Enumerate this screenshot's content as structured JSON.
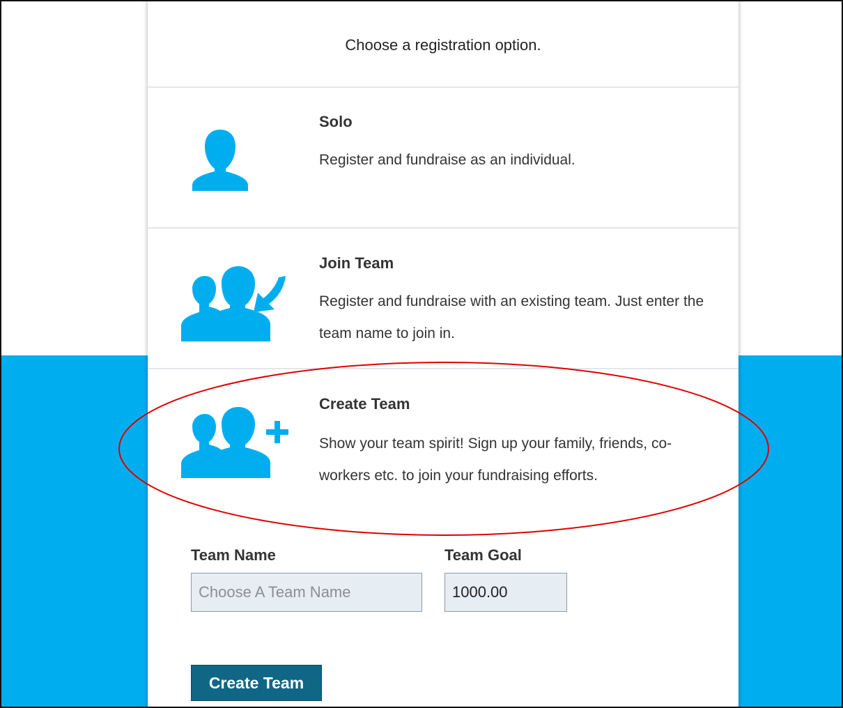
{
  "header": {
    "title": "Choose a registration option."
  },
  "options": [
    {
      "heading": "Solo",
      "description": "Register and fundraise as an individual.",
      "icon": "user-icon"
    },
    {
      "heading": "Join Team",
      "description": "Register and fundraise with an existing team. Just enter the team name to join in.",
      "icon": "join-team-icon"
    },
    {
      "heading": "Create Team",
      "description": "Show your team spirit! Sign up your family, friends, co-workers etc. to join your fundraising efforts.",
      "icon": "create-team-icon"
    }
  ],
  "form": {
    "team_name_label": "Team Name",
    "team_name_placeholder": "Choose A Team Name",
    "team_name_value": "",
    "team_goal_label": "Team Goal",
    "team_goal_value": "1000.00",
    "submit_label": "Create Team"
  },
  "colors": {
    "accent": "#00aeef",
    "button": "#0f6685",
    "annotation": "#e00000"
  }
}
